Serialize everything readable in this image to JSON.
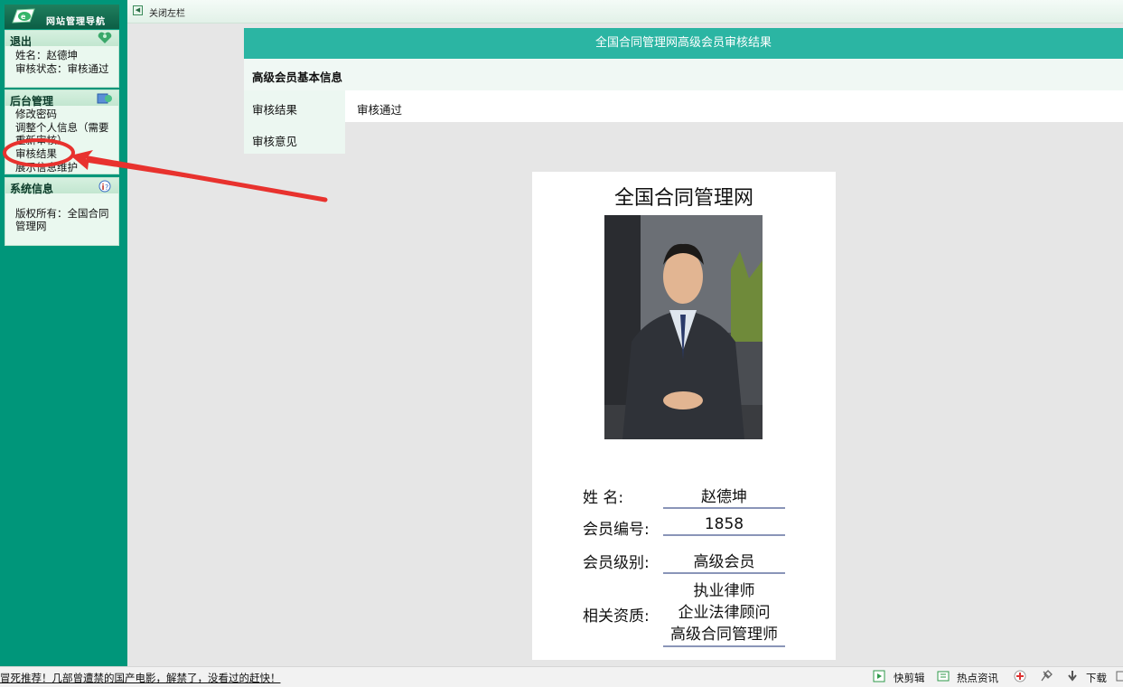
{
  "sidebar": {
    "header_title": "网站管理导航",
    "sections": [
      {
        "title": "退出",
        "items": [
          "姓名：赵德坤",
          "审核状态：审核通过"
        ]
      },
      {
        "title": "后台管理",
        "items": [
          "修改密码",
          "调整个人信息（需要重新审核）",
          "审核结果",
          "展示信息维护"
        ]
      },
      {
        "title": "系统信息",
        "items": [
          "版权所有：全国合同管理网"
        ]
      }
    ]
  },
  "topbar": {
    "close_label": "关闭左栏"
  },
  "main": {
    "header": "全国合同管理网高级会员审核结果",
    "basic_info": "高级会员基本信息",
    "rows": [
      {
        "label": "审核结果",
        "value": "审核通过"
      },
      {
        "label": "审核意见",
        "value": ""
      }
    ]
  },
  "card": {
    "title": "全国合同管理网",
    "fields": [
      {
        "label": "姓    名:",
        "value": "赵德坤"
      },
      {
        "label": "会员编号:",
        "value": "1858"
      },
      {
        "label": "会员级别:",
        "value": "高级会员"
      },
      {
        "label": "相关资质:",
        "values": [
          "执业律师",
          "企业法律顾问",
          "高级合同管理师"
        ]
      }
    ]
  },
  "bottombar": {
    "news": "冒死推荐！几部曾遭禁的国产电影，解禁了，没看过的赶快！",
    "items": [
      "快剪辑",
      "热点资讯",
      "下载"
    ]
  },
  "colors": {
    "sidebar": "#00967a",
    "header_teal": "#2bb5a3",
    "annotation": "#e8322e"
  }
}
